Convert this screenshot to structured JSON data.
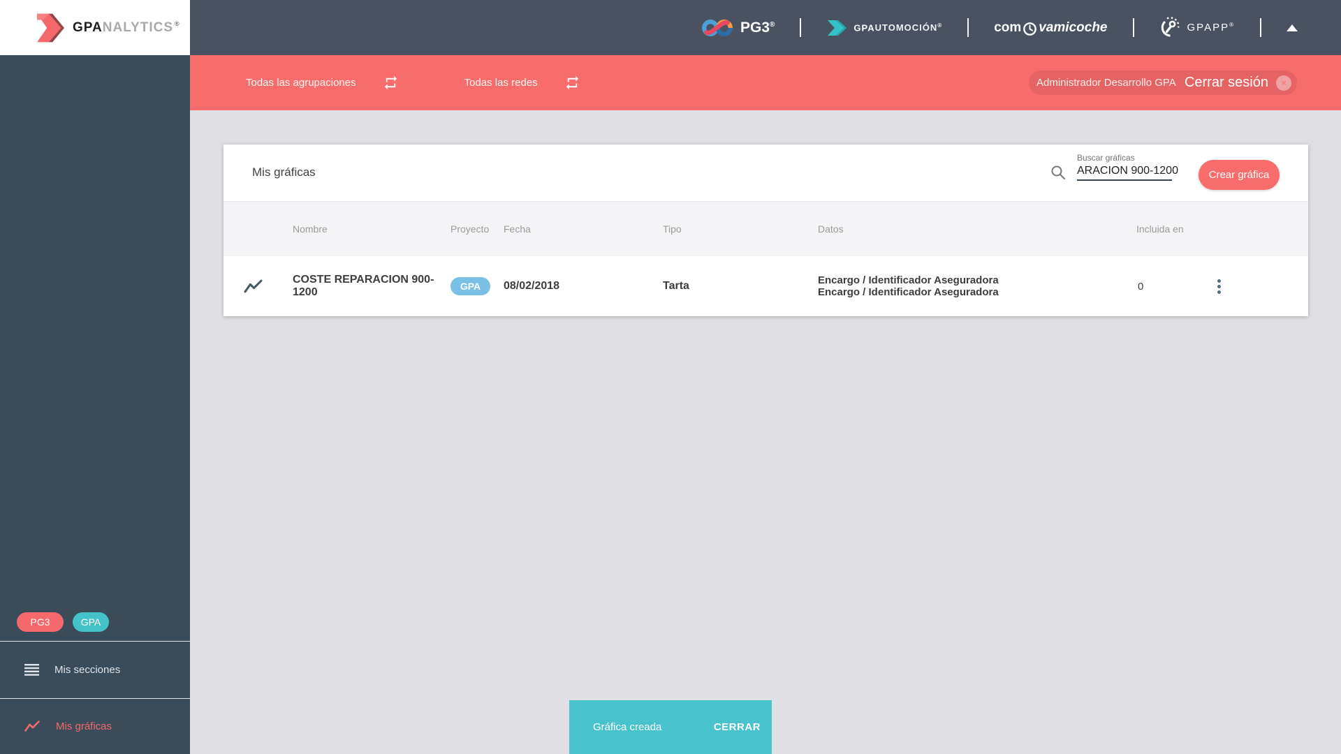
{
  "brand": {
    "logo_bold": "GPA",
    "logo_rest": "NALYTICS",
    "reg": "®"
  },
  "topbar": {
    "pg3": "PG3",
    "gpauto_bold": "GPA",
    "gpauto_rest": "UTOMOCIÓN",
    "comprova_pre": "com",
    "comprova_post": "vamicoche",
    "gpapp": "GPAPP",
    "reg": "®"
  },
  "filterbar": {
    "agrupaciones_label": "Todas las agrupaciones",
    "redes_label": "Todas las redes",
    "user_label": "Administrador Desarrollo GPA",
    "logout_label": "Cerrar sesión",
    "logout_close": "×"
  },
  "card": {
    "title": "Mis gráficas",
    "search_label": "Buscar gráficas",
    "search_value": "ARACION 900-1200",
    "create_button": "Crear gráfica"
  },
  "table": {
    "headers": {
      "nombre": "Nombre",
      "proyecto": "Proyecto",
      "fecha": "Fecha",
      "tipo": "Tipo",
      "datos": "Datos",
      "incluida": "Incluida en"
    },
    "row": {
      "nombre": "COSTE REPARACION 900-1200",
      "proyecto_badge": "GPA",
      "fecha": "08/02/2018",
      "tipo": "Tarta",
      "datos_line1": "Encargo / Identificador Aseguradora",
      "datos_line2": "Encargo / Identificador Aseguradora",
      "incluida": "0"
    }
  },
  "sidebar": {
    "badge_pg3": "PG3",
    "badge_gpa": "GPA",
    "sections_label": "Mis secciones",
    "charts_label": "Mis gráficas"
  },
  "snackbar": {
    "message": "Gráfica creada",
    "action": "CERRAR"
  },
  "colors": {
    "coral": "#f96c6c",
    "teal": "#48c3ce",
    "badge_blue": "#79c0e4",
    "topbar": "#4a5261",
    "sidebar": "#3a4b59",
    "page_bg": "#e0e0e4"
  }
}
